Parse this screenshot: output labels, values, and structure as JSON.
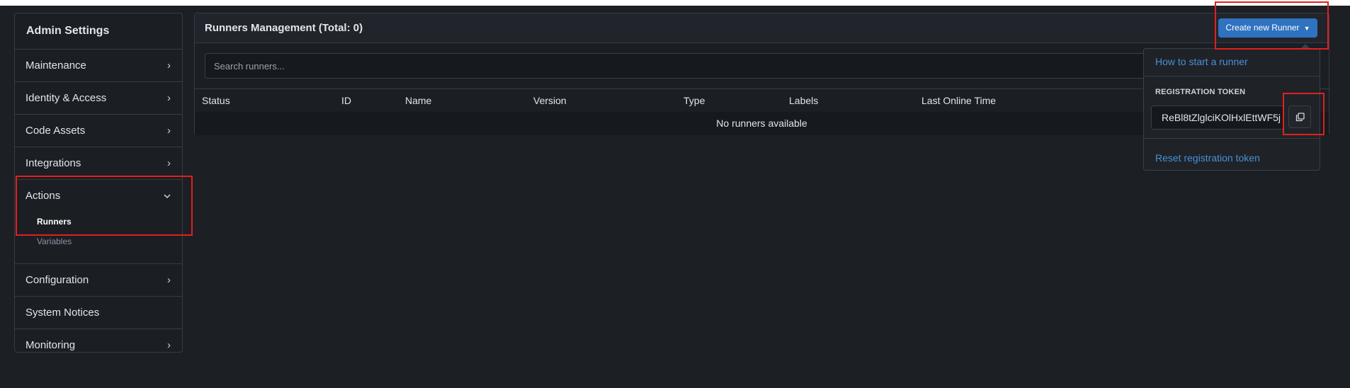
{
  "sidebar": {
    "title": "Admin Settings",
    "items": [
      {
        "label": "Maintenance"
      },
      {
        "label": "Identity & Access"
      },
      {
        "label": "Code Assets"
      },
      {
        "label": "Integrations"
      },
      {
        "label": "Actions",
        "subitems": [
          {
            "label": "Runners"
          },
          {
            "label": "Variables"
          }
        ]
      },
      {
        "label": "Configuration"
      },
      {
        "label": "System Notices"
      },
      {
        "label": "Monitoring"
      }
    ]
  },
  "main": {
    "title": "Runners Management (Total: 0)",
    "search": {
      "placeholder": "Search runners...",
      "value": ""
    },
    "columns": [
      "Status",
      "ID",
      "Name",
      "Version",
      "Type",
      "Labels",
      "Last Online Time"
    ],
    "empty_message": "No runners available"
  },
  "create_button": {
    "label": "Create new Runner"
  },
  "dropdown": {
    "how_to_link": "How to start a runner",
    "token_label": "REGISTRATION TOKEN",
    "token_value": "ReBl8tZlglciKOlHxlEttWF5j",
    "reset_link": "Reset registration token"
  },
  "colors": {
    "background": "#1c1f24",
    "accent": "#2f72c0",
    "link": "#4a8fd6",
    "highlight": "#e0201f"
  },
  "icons": {
    "chevron_right": "chevron-right-icon",
    "chevron_down": "chevron-down-icon",
    "caret_down": "caret-down-icon",
    "copy": "copy-icon"
  }
}
